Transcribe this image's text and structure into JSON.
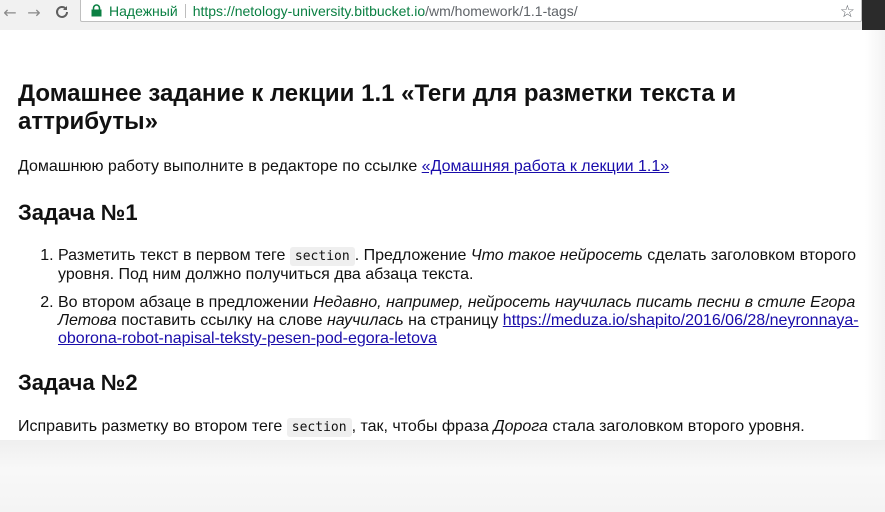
{
  "browser": {
    "secure_label": "Надежный",
    "url_scheme_host": "https://netology-university.bitbucket.io",
    "url_path": "/wm/homework/1.1-tags/",
    "icons": [
      "back-icon",
      "forward-icon",
      "reload-icon",
      "lock-icon",
      "star-icon"
    ]
  },
  "page": {
    "title": "Домашнее задание к лекции 1.1 «Теги для разметки текста и аттрибуты»",
    "intro_text": "Домашнюю работу выполните в редакторе по ссылке ",
    "intro_link": "«Домашняя работа к лекции 1.1»",
    "task1": {
      "heading": "Задача №1",
      "item1": {
        "part1": "Разметить текст в первом теге ",
        "code": "section",
        "part2": ". Предложение ",
        "em": "Что такое нейросеть",
        "part3": " сделать заголовком второго уровня. Под ним должно получиться два абзаца текста."
      },
      "item2": {
        "part1": "Во втором абзаце в предложении ",
        "em1": "Недавно, например, нейросеть научилась писать песни в стиле Егора Летова",
        "part2": " поставить ссылку на слове ",
        "em2": "научилась",
        "part3": " на страницу ",
        "link": "https://meduza.io/shapito/2016/06/28/neyronnaya-oborona-robot-napisal-teksty-pesen-pod-egora-letova"
      }
    },
    "task2": {
      "heading": "Задача №2",
      "part1": "Исправить разметку во втором теге ",
      "code": "section",
      "part2": ", так, чтобы фраза ",
      "em": "Дорога",
      "part3": " стала заголовком второго уровня."
    }
  },
  "colors": {
    "secure_green": "#0b8043",
    "link_blue": "#1a0dab",
    "code_bg": "#efefef"
  }
}
